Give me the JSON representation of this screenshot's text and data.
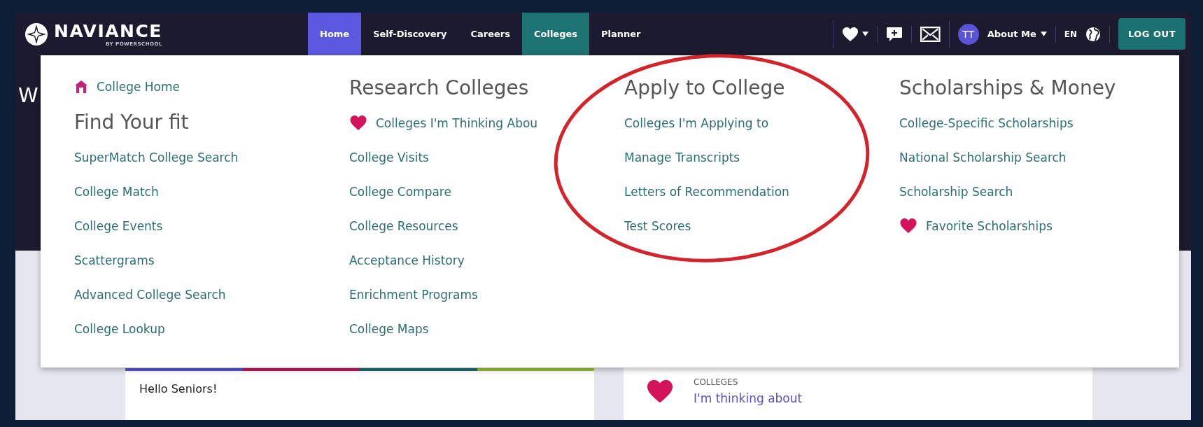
{
  "header": {
    "logo": {
      "name": "NAVIANCE",
      "tagline": "BY POWERSCHOOL"
    },
    "nav_tabs": [
      {
        "label": "Home",
        "selected": true,
        "expanded": false
      },
      {
        "label": "Self-Discovery",
        "selected": false,
        "expanded": false
      },
      {
        "label": "Careers",
        "selected": false,
        "expanded": false
      },
      {
        "label": "Colleges",
        "selected": false,
        "expanded": true
      },
      {
        "label": "Planner",
        "selected": false,
        "expanded": false
      }
    ],
    "user": {
      "initials": "TT",
      "menu_label": "About Me",
      "language": "EN"
    },
    "logout": "LOG OUT"
  },
  "page_heading": "W",
  "dropdown": {
    "columns": [
      {
        "entries": [
          {
            "kind": "home_link",
            "label": "College Home"
          },
          {
            "kind": "heading",
            "label": "Find Your fit"
          },
          {
            "kind": "link",
            "label": "SuperMatch College Search"
          },
          {
            "kind": "link",
            "label": "College Match"
          },
          {
            "kind": "link",
            "label": "College Events"
          },
          {
            "kind": "link",
            "label": "Scattergrams"
          },
          {
            "kind": "link",
            "label": "Advanced College Search"
          },
          {
            "kind": "link",
            "label": "College Lookup"
          }
        ]
      },
      {
        "entries": [
          {
            "kind": "heading",
            "label": "Research Colleges"
          },
          {
            "kind": "heart_link",
            "label": "Colleges I'm Thinking Abou"
          },
          {
            "kind": "link",
            "label": "College Visits"
          },
          {
            "kind": "link",
            "label": "College Compare"
          },
          {
            "kind": "link",
            "label": "College Resources"
          },
          {
            "kind": "link",
            "label": "Acceptance History"
          },
          {
            "kind": "link",
            "label": "Enrichment Programs"
          },
          {
            "kind": "link",
            "label": "College Maps"
          }
        ]
      },
      {
        "entries": [
          {
            "kind": "heading",
            "label": "Apply to College"
          },
          {
            "kind": "link",
            "label": "Colleges I'm Applying to"
          },
          {
            "kind": "link",
            "label": "Manage Transcripts"
          },
          {
            "kind": "link",
            "label": "Letters of Recommendation"
          },
          {
            "kind": "link",
            "label": "Test Scores"
          }
        ]
      },
      {
        "entries": [
          {
            "kind": "heading",
            "label": "Scholarships & Money"
          },
          {
            "kind": "link",
            "label": "College-Specific Scholarships"
          },
          {
            "kind": "link",
            "label": "National Scholarship Search"
          },
          {
            "kind": "link",
            "label": "Scholarship Search"
          },
          {
            "kind": "heart_link",
            "label": "Favorite Scholarships"
          }
        ]
      }
    ]
  },
  "cards": [
    {
      "kind": "announcement",
      "text": "Hello Seniors!"
    },
    {
      "kind": "colleges",
      "category": "COLLEGES",
      "link": "I'm thinking about"
    }
  ]
}
